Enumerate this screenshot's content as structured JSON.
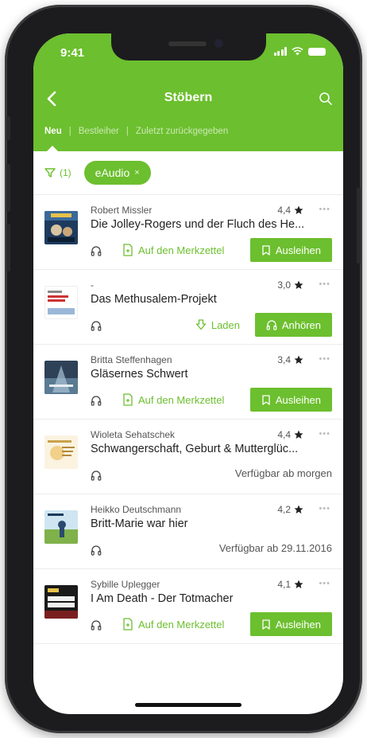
{
  "status": {
    "time": "9:41"
  },
  "header": {
    "title": "Stöbern"
  },
  "tabs": [
    "Neu",
    "Bestleiher",
    "Zuletzt zurückgegeben"
  ],
  "filter": {
    "count": "(1)",
    "chip_label": "eAudio",
    "chip_x": "×"
  },
  "colors": {
    "accent": "#6cbf2e"
  },
  "items": [
    {
      "author": "Robert Missler",
      "rating": "4,4",
      "more": "•••",
      "title": "Die Jolley-Rogers und der Fluch des He...",
      "link": "Auf den Merkzettel",
      "button": "Ausleihen"
    },
    {
      "author": "-",
      "rating": "3,0",
      "more": "•••",
      "title": "Das Methusalem-Projekt",
      "link": "Laden",
      "button": "Anhören"
    },
    {
      "author": "Britta Steffenhagen",
      "rating": "3,4",
      "more": "•••",
      "title": "Gläsernes Schwert",
      "link": "Auf den Merkzettel",
      "button": "Ausleihen"
    },
    {
      "author": "Wioleta Sehatschek",
      "rating": "4,4",
      "more": "•••",
      "title": "Schwangerschaft, Geburt & Mutterglüc...",
      "availability": "Verfügbar ab morgen"
    },
    {
      "author": "Heikko Deutschmann",
      "rating": "4,2",
      "more": "•••",
      "title": "Britt-Marie war hier",
      "availability": "Verfügbar ab 29.11.2016"
    },
    {
      "author": "Sybille Uplegger",
      "rating": "4,1",
      "more": "•••",
      "title": "I Am Death - Der Totmacher",
      "link": "Auf den Merkzettel",
      "button": "Ausleihen"
    }
  ]
}
